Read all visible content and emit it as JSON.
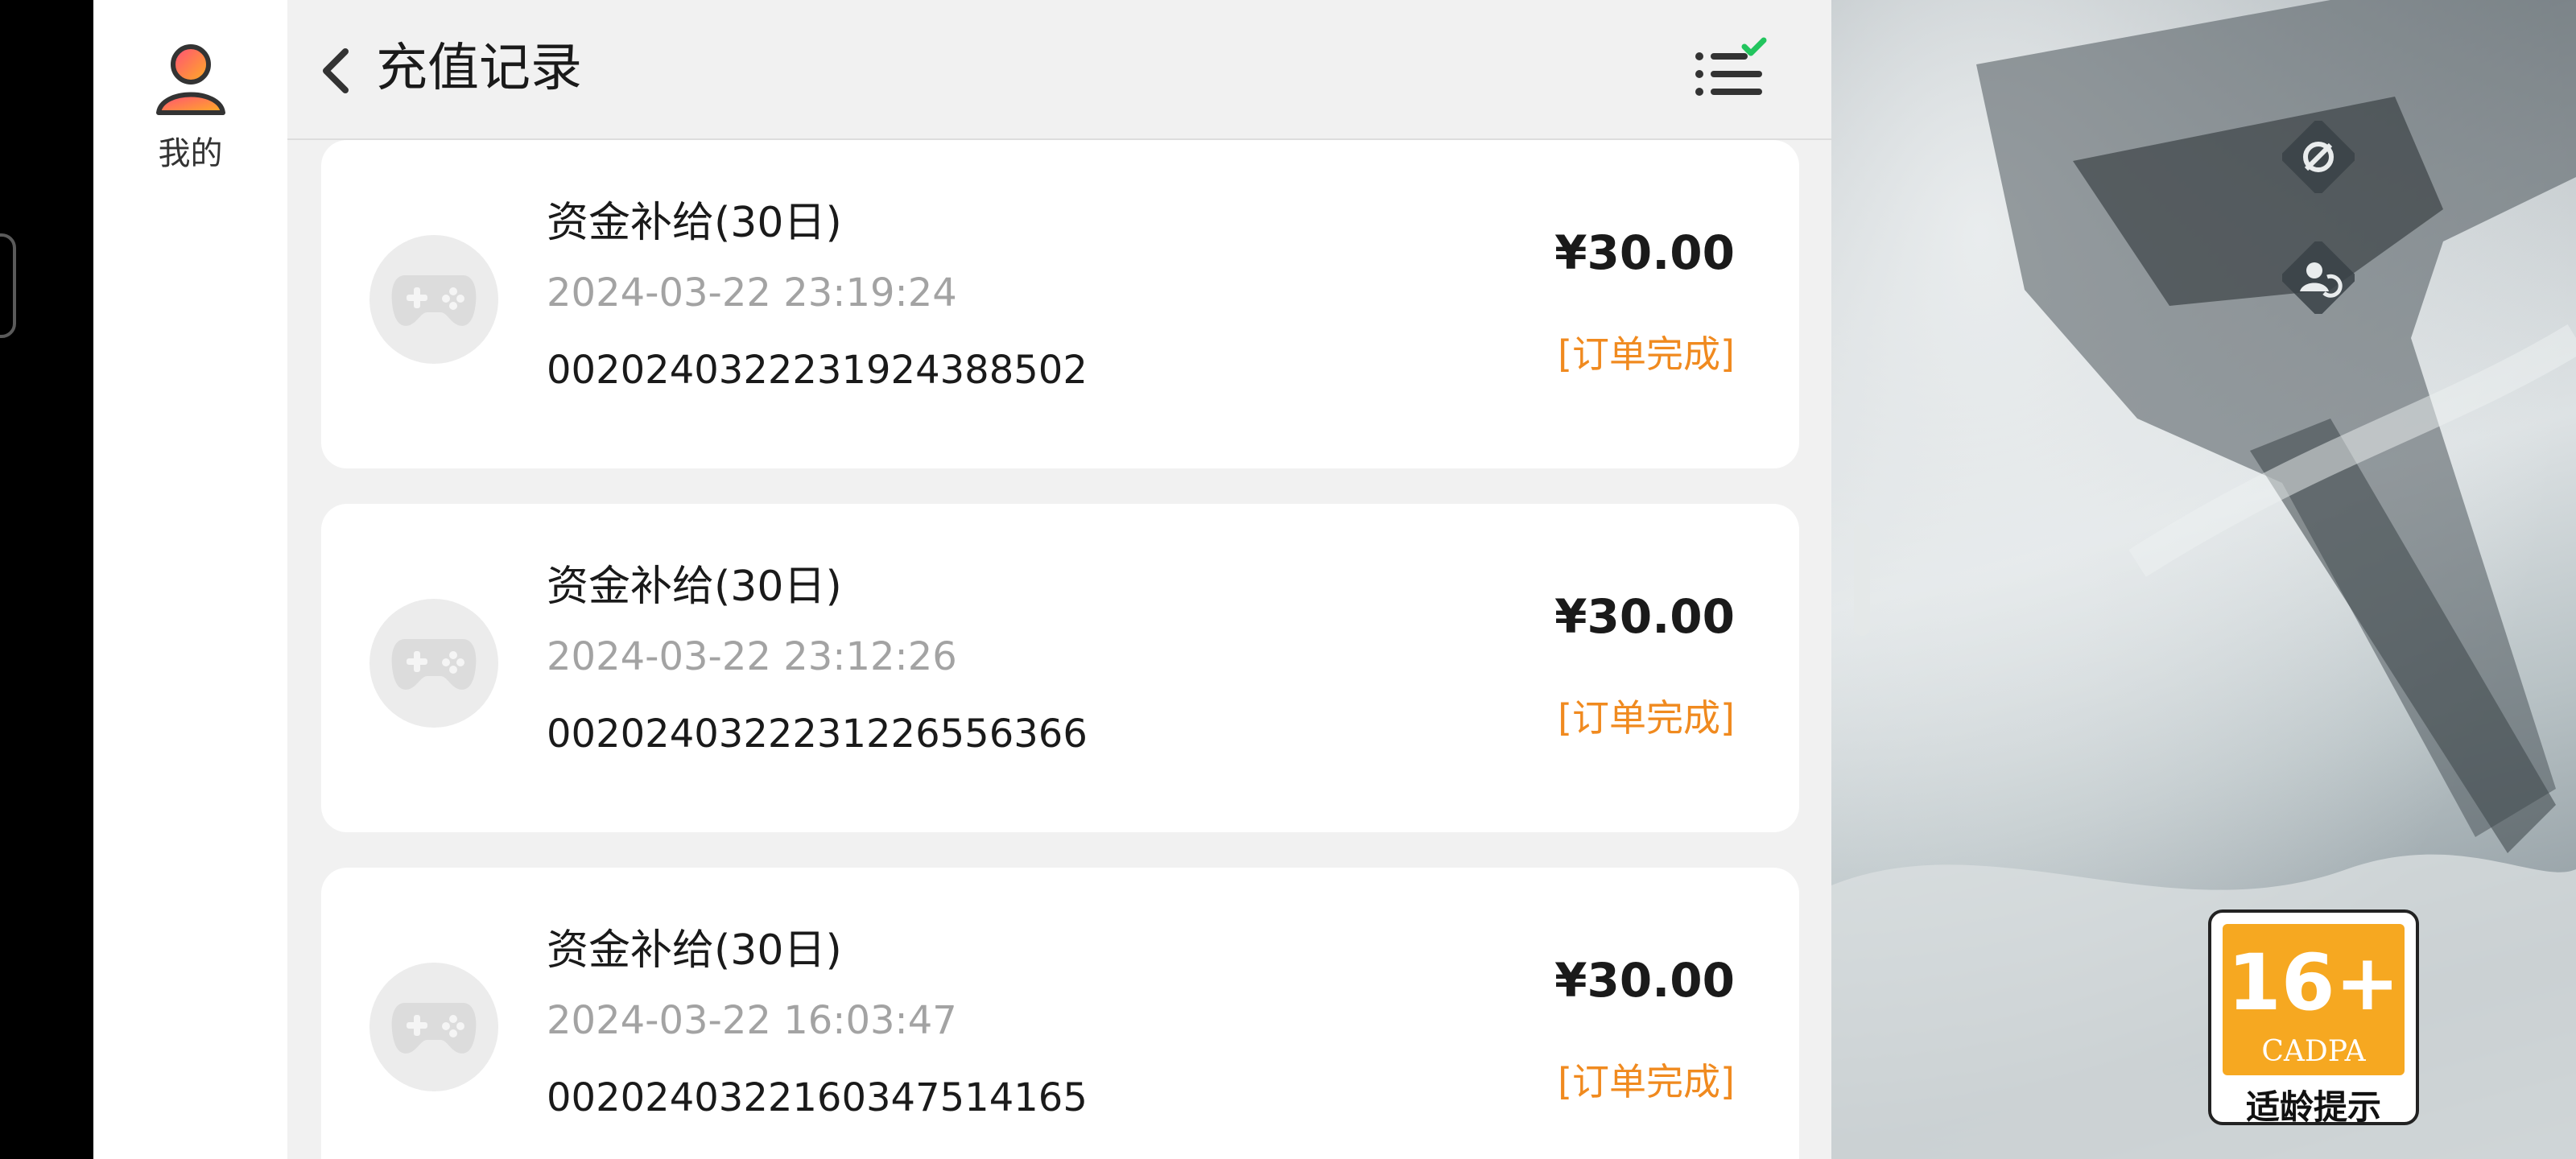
{
  "sidebar": {
    "user_label": "我的"
  },
  "header": {
    "title": "充值记录"
  },
  "records": [
    {
      "title": "资金补给(30日)",
      "time": "2024-03-22 23:19:24",
      "order_id": "0020240322231924388502",
      "price": "¥30.00",
      "status": "[订单完成]"
    },
    {
      "title": "资金补给(30日)",
      "time": "2024-03-22 23:12:26",
      "order_id": "0020240322231226556366",
      "price": "¥30.00",
      "status": "[订单完成]"
    },
    {
      "title": "资金补给(30日)",
      "time": "2024-03-22 16:03:47",
      "order_id": "0020240322160347514165",
      "price": "¥30.00",
      "status": "[订单完成]"
    }
  ],
  "rating": {
    "age": "16+",
    "org": "CADPA",
    "tip": "适龄提示"
  },
  "icons": {
    "back": "chevron-left-icon",
    "filter": "checklist-icon",
    "avatar": "user-avatar-icon",
    "game": "gamepad-icon"
  },
  "colors": {
    "status_accent": "#f08a1f",
    "check_accent": "#22c55e",
    "rating_orange": "#f6a821",
    "panel_bg": "#f1f1f1"
  }
}
